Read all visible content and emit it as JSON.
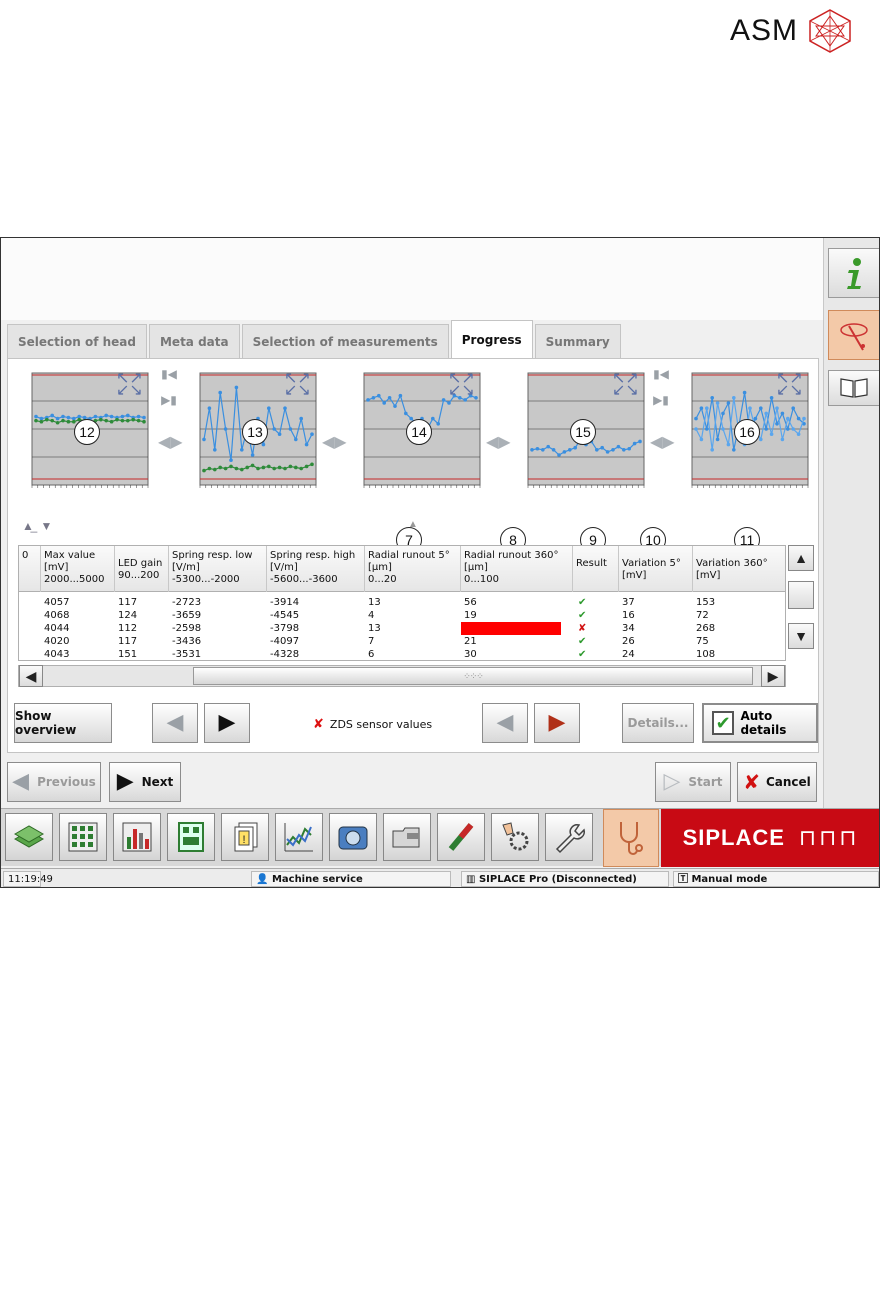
{
  "logo": {
    "text": "ASM"
  },
  "tabs": [
    {
      "label": "Selection of head",
      "active": false
    },
    {
      "label": "Meta data",
      "active": false
    },
    {
      "label": "Selection of measurements",
      "active": false
    },
    {
      "label": "Progress",
      "active": true
    },
    {
      "label": "Summary",
      "active": false
    }
  ],
  "charts": [
    {
      "callout": "12",
      "series": [
        {
          "color": "#3a8fe0",
          "values": [
            0.62,
            0.6,
            0.61,
            0.63,
            0.6,
            0.62,
            0.61,
            0.6,
            0.62,
            0.61,
            0.6,
            0.62,
            0.61,
            0.63,
            0.62,
            0.61,
            0.62,
            0.63,
            0.61,
            0.62,
            0.61
          ]
        },
        {
          "color": "#2e8b3a",
          "values": [
            0.58,
            0.57,
            0.59,
            0.58,
            0.56,
            0.58,
            0.57,
            0.57,
            0.59,
            0.58,
            0.57,
            0.58,
            0.59,
            0.58,
            0.57,
            0.59,
            0.58,
            0.58,
            0.59,
            0.58,
            0.57
          ]
        }
      ]
    },
    {
      "callout": "13",
      "series": [
        {
          "color": "#3a8fe0",
          "values": [
            0.4,
            0.7,
            0.3,
            0.85,
            0.5,
            0.2,
            0.9,
            0.3,
            0.5,
            0.25,
            0.6,
            0.35,
            0.7,
            0.5,
            0.45,
            0.7,
            0.5,
            0.4,
            0.6,
            0.35,
            0.45
          ]
        },
        {
          "color": "#2e8b3a",
          "values": [
            0.1,
            0.12,
            0.11,
            0.13,
            0.12,
            0.14,
            0.12,
            0.11,
            0.13,
            0.15,
            0.12,
            0.13,
            0.14,
            0.12,
            0.13,
            0.12,
            0.14,
            0.13,
            0.12,
            0.14,
            0.16
          ]
        }
      ]
    },
    {
      "callout": "14",
      "series": [
        {
          "color": "#3a8fe0",
          "values": [
            0.78,
            0.8,
            0.82,
            0.75,
            0.8,
            0.72,
            0.82,
            0.65,
            0.6,
            0.55,
            0.6,
            0.5,
            0.6,
            0.55,
            0.78,
            0.75,
            0.82,
            0.8,
            0.78,
            0.82,
            0.8
          ]
        }
      ]
    },
    {
      "callout": "15",
      "series": [
        {
          "color": "#3a8fe0",
          "values": [
            0.3,
            0.31,
            0.3,
            0.33,
            0.3,
            0.25,
            0.28,
            0.3,
            0.32,
            0.4,
            0.35,
            0.38,
            0.3,
            0.32,
            0.28,
            0.3,
            0.33,
            0.3,
            0.31,
            0.36,
            0.38
          ]
        }
      ]
    },
    {
      "callout": "16",
      "series": [
        {
          "color": "#3a8fe0",
          "values": [
            0.6,
            0.7,
            0.5,
            0.8,
            0.4,
            0.65,
            0.75,
            0.3,
            0.55,
            0.85,
            0.45,
            0.6,
            0.7,
            0.5,
            0.8,
            0.55,
            0.65,
            0.5,
            0.7,
            0.6,
            0.55
          ]
        },
        {
          "color": "#5aa6ee",
          "values": [
            0.5,
            0.4,
            0.7,
            0.3,
            0.75,
            0.5,
            0.35,
            0.8,
            0.45,
            0.35,
            0.7,
            0.5,
            0.4,
            0.65,
            0.45,
            0.7,
            0.4,
            0.6,
            0.5,
            0.45,
            0.6
          ]
        }
      ]
    }
  ],
  "column_callouts": [
    "7",
    "8",
    "9",
    "10",
    "11"
  ],
  "table": {
    "headers": [
      {
        "lines": [
          "",
          "",
          "0"
        ]
      },
      {
        "lines": [
          "Max value",
          "[mV]",
          "2000...5000"
        ]
      },
      {
        "lines": [
          "LED gain",
          "90...200",
          ""
        ]
      },
      {
        "lines": [
          "Spring resp. low",
          "[V/m]",
          "-5300...-2000"
        ]
      },
      {
        "lines": [
          "Spring resp. high",
          "[V/m]",
          "-5600...-3600"
        ]
      },
      {
        "lines": [
          "Radial runout 5°",
          "[µm]",
          "0...20"
        ]
      },
      {
        "lines": [
          "Radial runout 360°",
          "[µm]",
          "0...100"
        ]
      },
      {
        "lines": [
          "",
          "Result",
          ""
        ]
      },
      {
        "lines": [
          "Variation 5°",
          "[mV]",
          ""
        ]
      },
      {
        "lines": [
          "Variation 360°",
          "[mV]",
          ""
        ]
      }
    ],
    "rows": [
      {
        "max": "4057",
        "led": "117",
        "low": "-2723",
        "high": "-3914",
        "r5": "13",
        "r360": "56",
        "result": "ok",
        "v5": "37",
        "v360": "153"
      },
      {
        "max": "4068",
        "led": "124",
        "low": "-3659",
        "high": "-4545",
        "r5": "4",
        "r360": "19",
        "result": "ok",
        "v5": "16",
        "v360": "72"
      },
      {
        "max": "4044",
        "led": "112",
        "low": "-2598",
        "high": "-3798",
        "r5": "13",
        "r360": "100",
        "result": "fail",
        "v5": "34",
        "v360": "268"
      },
      {
        "max": "4020",
        "led": "117",
        "low": "-3436",
        "high": "-4097",
        "r5": "7",
        "r360": "21",
        "result": "ok",
        "v5": "26",
        "v360": "75"
      },
      {
        "max": "4043",
        "led": "151",
        "low": "-3531",
        "high": "-4328",
        "r5": "6",
        "r360": "30",
        "result": "ok",
        "v5": "24",
        "v360": "108"
      }
    ]
  },
  "buttons": {
    "show_overview": "Show overview",
    "zds": "ZDS sensor values",
    "details": "Details...",
    "auto_details": "Auto details",
    "previous": "Previous",
    "next": "Next",
    "start": "Start",
    "cancel": "Cancel"
  },
  "siplace": "SIPLACE",
  "status": {
    "time": "11:19:49",
    "user": "Machine service",
    "connection": "SIPLACE Pro (Disconnected)",
    "mode": "Manual mode"
  },
  "colors": {
    "accent": "#c80a14",
    "active_tool": "#f3c9a8",
    "ok": "#2e9a2e",
    "fail": "#d11111"
  }
}
